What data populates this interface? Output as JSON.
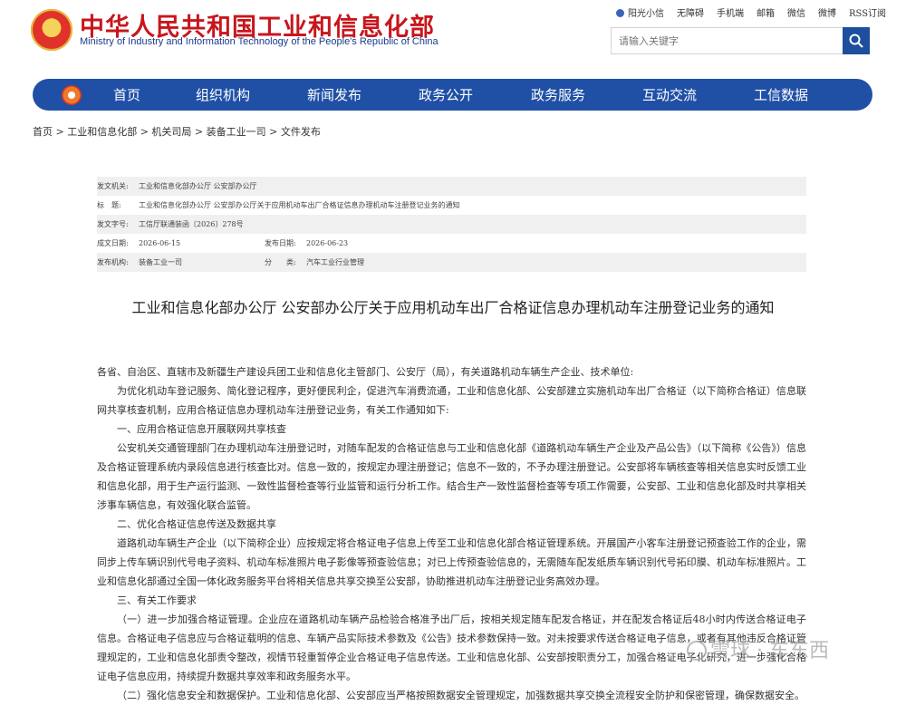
{
  "site": {
    "name_cn": "中华人民共和国工业和信息化部",
    "name_en": "Ministry of Industry and Information Technology of the People's Republic of China"
  },
  "toplinks": [
    "阳光小信",
    "无障碍",
    "手机端",
    "邮箱",
    "微信",
    "微博",
    "RSS订阅"
  ],
  "search": {
    "placeholder": "请输入关键字"
  },
  "nav": [
    "首页",
    "组织机构",
    "新闻发布",
    "政务公开",
    "政务服务",
    "互动交流",
    "工信数据"
  ],
  "breadcrumb": "首页 > 工业和信息化部 > 机关司局 > 装备工业一司 > 文件发布",
  "meta": {
    "issuer_label": "发文机关:",
    "issuer": "工业和信息化部办公厅 公安部办公厅",
    "title_label": "标　题:",
    "title": "工业和信息化部办公厅 公安部办公厅关于应用机动车出厂合格证信息办理机动车注册登记业务的通知",
    "doc_no_label": "发文字号:",
    "doc_no": "工信厅联通装函〔2026〕278号",
    "created_label": "成文日期:",
    "created": "2026-06-15",
    "published_label": "发布日期:",
    "published": "2026-06-23",
    "org_label": "发布机构:",
    "org": "装备工业一司",
    "category_label": "分　　类:",
    "category": "汽车工业行业管理"
  },
  "doc_title": "工业和信息化部办公厅 公安部办公厅关于应用机动车出厂合格证信息办理机动车注册登记业务的通知",
  "body": {
    "p0": "各省、自治区、直辖市及新疆生产建设兵团工业和信息化主管部门、公安厅（局），有关道路机动车辆生产企业、技术单位:",
    "p1": "为优化机动车登记服务、简化登记程序，更好便民利企，促进汽车消费流通，工业和信息化部、公安部建立实施机动车出厂合格证（以下简称合格证）信息联网共享核查机制，应用合格证信息办理机动车注册登记业务，有关工作通知如下:",
    "h1": "一、应用合格证信息开展联网共享核查",
    "p2": "公安机关交通管理部门在办理机动车注册登记时，对随车配发的合格证信息与工业和信息化部《道路机动车辆生产企业及产品公告》（以下简称《公告》）信息及合格证管理系统内录段信息进行核查比对。信息一致的，按规定办理注册登记；信息不一致的，不予办理注册登记。公安部将车辆核查等相关信息实时反馈工业和信息化部，用于生产运行监测、一致性监督检查等行业监管和运行分析工作。结合生产一致性监督检查等专项工作需要，公安部、工业和信息化部及时共享相关涉事车辆信息，有效强化联合监管。",
    "h2": "二、优化合格证信息传送及数据共享",
    "p3": "道路机动车辆生产企业（以下简称企业）应按规定将合格证电子信息上传至工业和信息化部合格证管理系统。开展国产小客车注册登记预查验工作的企业，需同步上传车辆识别代号电子资料、机动车标准照片电子影像等预查验信息；对已上传预查验信息的，无需随车配发纸质车辆识别代号拓印膜、机动车标准照片。工业和信息化部通过全国一体化政务服务平台将相关信息共享交换至公安部，协助推进机动车注册登记业务高效办理。",
    "h3": "三、有关工作要求",
    "p4": "（一）进一步加强合格证管理。企业应在道路机动车辆产品检验合格准予出厂后，按相关规定随车配发合格证，并在配发合格证后48小时内传送合格证电子信息。合格证电子信息应与合格证载明的信息、车辆产品实际技术参数及《公告》技术参数保持一致。对未按要求传送合格证电子信息，或者有其他违反合格证管理规定的，工业和信息化部责令整改，视情节轻重暂停企业合格证电子信息传送。工业和信息化部、公安部按职责分工，加强合格证电子化研究，进一步强化合格证电子信息应用，持续提升数据共享效率和政务服务水平。",
    "p5": "（二）强化信息安全和数据保护。工业和信息化部、公安部应当严格按照数据安全管理规定，加强数据共享交换全流程安全防护和保密管理，确保数据安全。"
  },
  "watermark": "雪球 · 车东西"
}
